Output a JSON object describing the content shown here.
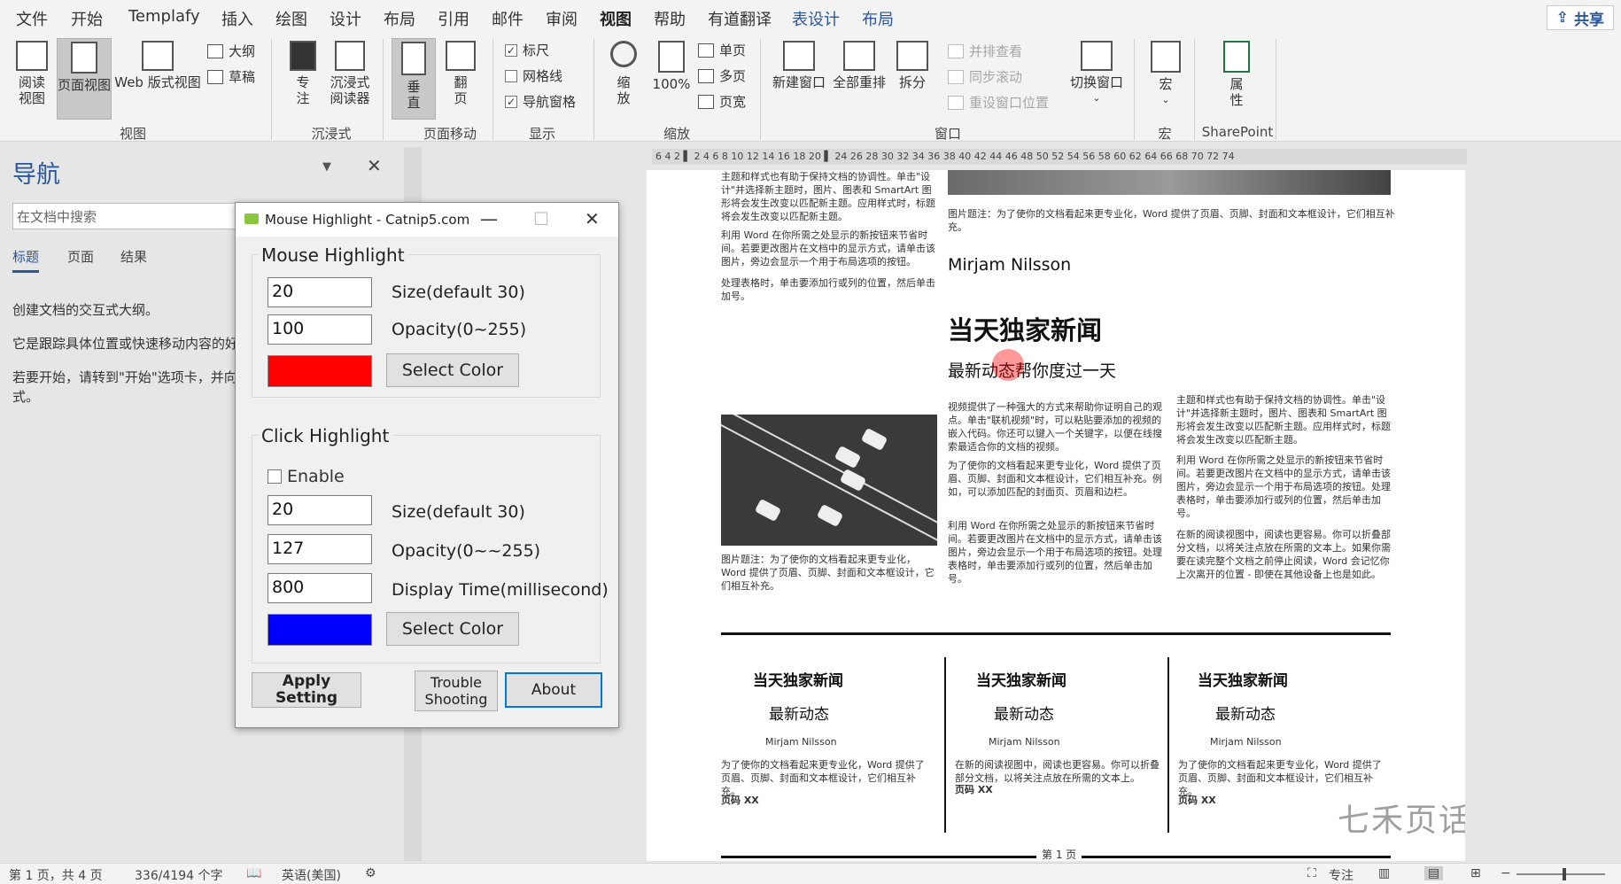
{
  "tabs": [
    "文件",
    "开始",
    "Templafy",
    "插入",
    "绘图",
    "设计",
    "布局",
    "引用",
    "邮件",
    "审阅",
    "视图",
    "帮助",
    "有道翻译",
    "表设计",
    "布局"
  ],
  "active_tab": "视图",
  "share_label": "共享",
  "ribbon": {
    "read_view": "阅读视图",
    "print_layout": "页面视图",
    "web_layout": "Web 版式视图",
    "outline": "大纲",
    "draft": "草稿",
    "focus": "专注",
    "immersive_reader": "沉浸式阅读器",
    "vertical": "垂直",
    "side_to_side": "翻页",
    "ruler": "标尺",
    "gridlines": "网格线",
    "nav_pane": "导航窗格",
    "zoom": "缩放",
    "zoom100": "100%",
    "one_page": "单页",
    "multi_page": "多页",
    "page_width": "页宽",
    "new_window": "新建窗口",
    "arrange_all": "全部重排",
    "split": "拆分",
    "side_by_side": "并排查看",
    "sync_scroll": "同步滚动",
    "reset_pos": "重设窗口位置",
    "switch_window": "切换窗口",
    "macros": "宏",
    "properties": "属性",
    "groups": {
      "views": "视图",
      "immersive": "沉浸式",
      "page_movement": "页面移动",
      "show": "显示",
      "zoom": "缩放",
      "window": "窗口",
      "macros": "宏",
      "sharepoint": "SharePoint"
    }
  },
  "nav": {
    "title": "导航",
    "search_placeholder": "在文档中搜索",
    "tabs": [
      "标题",
      "页面",
      "结果"
    ],
    "p1": "创建文档的交互式大纲。",
    "p2": "它是跟踪具体位置或快速移动内容的好",
    "p3": "若要开始，请转到\"开始\"选项卡，并向",
    "p3b": "式。"
  },
  "ruler_text": "6  4  2  ▌ 2  4  6  8  10  12  14  16  18  20  ▌ 24  26  28  30  32  34  36  38  40  42  44  46  48  50  52  54  56  58  60  62  64  66 68  70  72  74",
  "document": {
    "col1_top": "主题和样式也有助于保持文档的协调性。单击\"设计\"并选择新主题时，图片、图表和 SmartArt 图形将会发生改变以匹配新主题。应用样式时，标题将会发生改变以匹配新主题。",
    "col1_p2": "利用 Word 在你所需之处显示的新按钮来节省时间。若要更改图片在文档中的显示方式，请单击该图片，旁边会显示一个用于布局选项的按钮。",
    "col1_p3": "处理表格时，单击要添加行或列的位置，然后单击加号。",
    "caption_top": "图片题注：为了使你的文档看起来更专业化，Word 提供了页眉、页脚、封面和文本框设计，它们相互补充。",
    "author": "Mirjam Nilsson",
    "headline": "当天独家新闻",
    "subhead": "最新动态帮你度过一天",
    "mid_col1": "视频提供了一种强大的方式来帮助你证明自己的观点。单击\"联机视频\"时，可以粘贴要添加的视频的嵌入代码。你还可以键入一个关键字，以便在线搜索最适合你的文档的视频。",
    "mid_col1b": "为了使你的文档看起来更专业化，Word 提供了页眉、页脚、封面和文本框设计，它们相互补充。例如，可以添加匹配的封面页、页眉和边栏。",
    "mid_col1c": "利用 Word 在你所需之处显示的新按钮来节省时间。若要更改图片在文档中的显示方式，请单击该图片，旁边会显示一个用于布局选项的按钮。处理表格时，单击要添加行或列的位置，然后单击加号。",
    "mid_col2": "主题和样式也有助于保持文档的协调性。单击\"设计\"并选择新主题时，图片、图表和 SmartArt 图形将会发生改变以匹配新主题。应用样式时，标题将会发生改变以匹配新主题。",
    "mid_col2b": "利用 Word 在你所需之处显示的新按钮来节省时间。若要更改图片在文档中的显示方式，请单击该图片，旁边会显示一个用于布局选项的按钮。处理表格时，单击要添加行或列的位置，然后单击加号。",
    "mid_col2c": "在新的阅读视图中，阅读也更容易。你可以折叠部分文档，以将关注点放在所需的文本上。如果你需要在读完整个文档之前停止阅读，Word 会记忆你上次离开的位置 - 即使在其他设备上也是如此。",
    "caption_left": "图片题注：为了使你的文档看起来更专业化，Word 提供了页眉、页脚、封面和文本框设计，它们相互补充。",
    "card_head": "当天独家新闻",
    "card_sub": "最新动态",
    "card_author": "Mirjam Nilsson",
    "card1_body": "为了使你的文档看起来更专业化，Word 提供了页眉、页脚、封面和文本框设计，它们相互补充。",
    "card2_body": "在新的阅读视图中，阅读也更容易。你可以折叠部分文档，以将关注点放在所需的文本上。",
    "card3_body": "为了使你的文档看起来更专业化，Word 提供了页眉、页脚、封面和文本框设计，它们相互补充。",
    "page_code": "页码 XX",
    "footer_page": "第 1 页",
    "watermark": "七禾页话"
  },
  "dialog": {
    "title": "Mouse Highlight - Catnip5.com",
    "mouse_group": "Mouse Highlight",
    "mouse_size": "20",
    "mouse_size_label": "Size(default 30)",
    "mouse_opacity": "100",
    "mouse_opacity_label": "Opacity(0~255)",
    "mouse_color": "#ff0000",
    "select_color": "Select Color",
    "click_group": "Click Highlight",
    "enable_label": "Enable",
    "click_size": "20",
    "click_size_label": "Size(default 30)",
    "click_opacity": "127",
    "click_opacity_label": "Opacity(0~~255)",
    "click_display": "800",
    "click_display_label": "Display Time(millisecond)",
    "click_color": "#0000ff",
    "apply": "Apply Setting",
    "trouble1": "Trouble",
    "trouble2": "Shooting",
    "about": "About"
  },
  "status": {
    "page": "第 1 页，共 4 页",
    "words": "336/4194 个字",
    "lang": "英语(美国)",
    "focus": "专注"
  },
  "colors": {
    "accent": "#2b579a",
    "mouse_color": "#ff0000",
    "click_color": "#0000ff"
  }
}
